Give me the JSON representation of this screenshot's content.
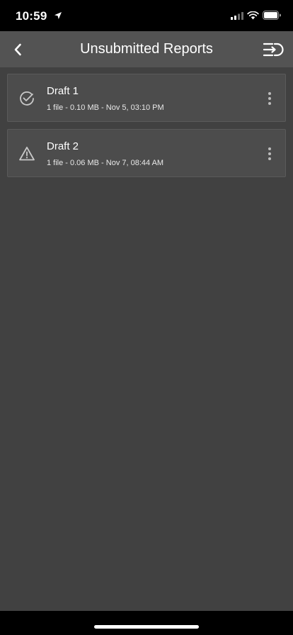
{
  "status_bar": {
    "time": "10:59",
    "icons": [
      "location-arrow-icon",
      "cellular-signal-icon",
      "wifi-icon",
      "battery-icon"
    ]
  },
  "header": {
    "title": "Unsubmitted Reports",
    "back_icon": "chevron-left-icon",
    "right_icon": "sort-exit-icon"
  },
  "reports": [
    {
      "title": "Draft 1",
      "meta": "1 file - 0.10 MB - Nov 5, 03:10 PM",
      "status_icon": "check-circle-icon"
    },
    {
      "title": "Draft 2",
      "meta": "1 file - 0.06 MB - Nov 7, 08:44 AM",
      "status_icon": "warning-triangle-icon"
    }
  ],
  "colors": {
    "background": "#414141",
    "header": "#535353",
    "card": "#4c4c4c",
    "icon": "#c8c8c8",
    "text": "#ffffff"
  }
}
